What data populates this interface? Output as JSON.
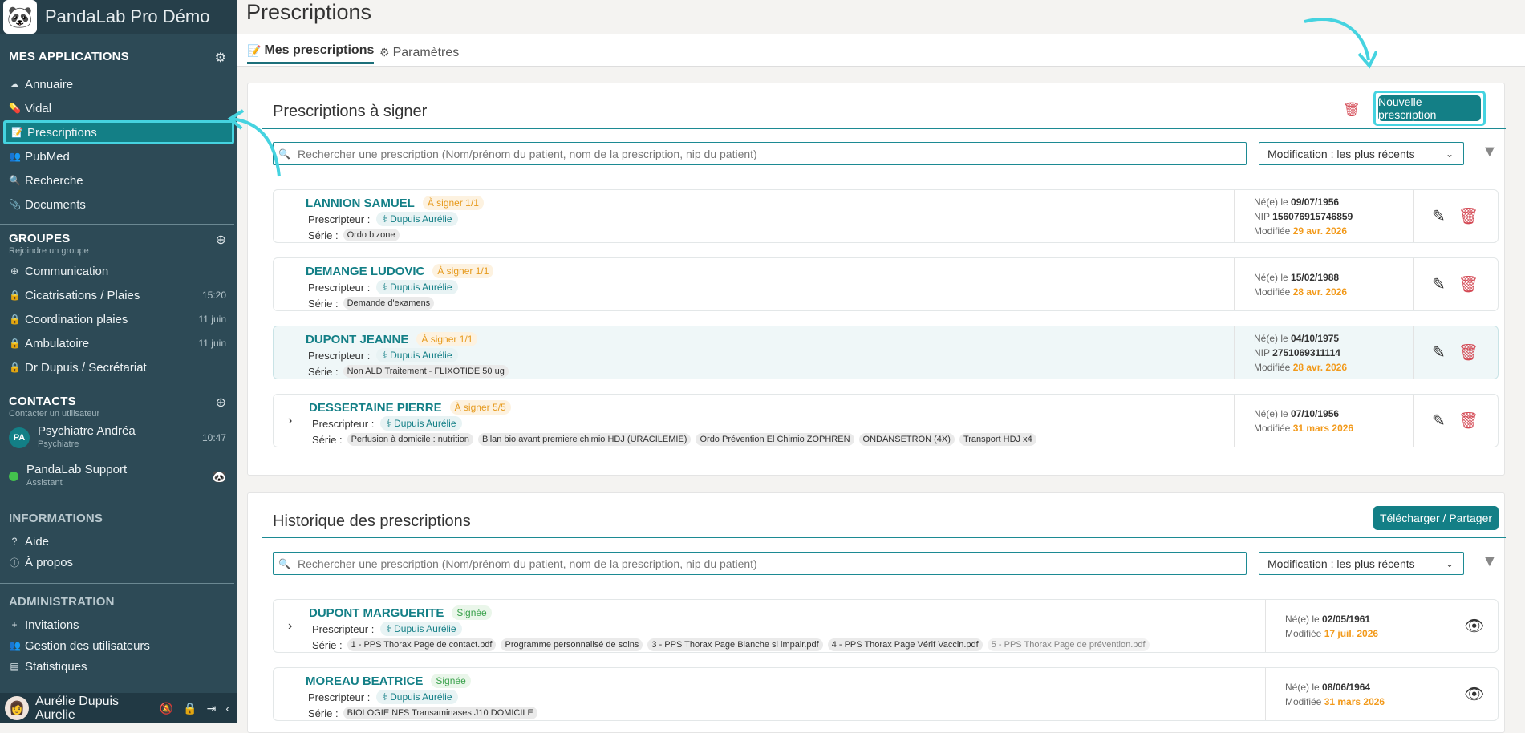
{
  "app": {
    "name": "PandaLab Pro Démo"
  },
  "sidebar": {
    "apps_title": "MES APPLICATIONS",
    "apps": [
      {
        "label": "Annuaire"
      },
      {
        "label": "Vidal"
      },
      {
        "label": "Prescriptions"
      },
      {
        "label": "PubMed"
      },
      {
        "label": "Recherche"
      },
      {
        "label": "Documents"
      }
    ],
    "groups_title": "GROUPES",
    "groups_sub": "Rejoindre un groupe",
    "groups": [
      {
        "label": "Communication",
        "time": ""
      },
      {
        "label": "Cicatrisations / Plaies",
        "time": "15:20"
      },
      {
        "label": "Coordination plaies",
        "time": "11 juin"
      },
      {
        "label": "Ambulatoire",
        "time": "11 juin"
      },
      {
        "label": "Dr Dupuis / Secrétariat",
        "time": ""
      }
    ],
    "contacts_title": "CONTACTS",
    "contacts_sub": "Contacter un utilisateur",
    "contacts": [
      {
        "initials": "PA",
        "name": "Psychiatre Andréa",
        "role": "Psychiatre",
        "time": "10:47"
      },
      {
        "name": "PandaLab Support",
        "role": "Assistant"
      }
    ],
    "info_title": "INFORMATIONS",
    "info": [
      {
        "label": "Aide"
      },
      {
        "label": "À propos"
      }
    ],
    "admin_title": "ADMINISTRATION",
    "admin": [
      {
        "label": "Invitations"
      },
      {
        "label": "Gestion des utilisateurs"
      },
      {
        "label": "Statistiques"
      }
    ],
    "user": {
      "first": "Aurélie Dupuis",
      "second": "Aurelie"
    }
  },
  "page": {
    "title": "Prescriptions",
    "tabs": [
      {
        "label": "Mes prescriptions"
      },
      {
        "label": "Paramètres"
      }
    ]
  },
  "to_sign": {
    "title": "Prescriptions à signer",
    "new_button": "Nouvelle prescription",
    "search_placeholder": "Rechercher une prescription (Nom/prénom du patient, nom de la prescription, nip du patient)",
    "sort": "Modification : les plus récents",
    "rows": [
      {
        "name": "LANNION SAMUEL",
        "status": "À signer 1/1",
        "prescriber_label": "Prescripteur :",
        "prescriber": "Dupuis Aurélie",
        "serie_label": "Série :",
        "tags": [
          "Ordo bizone"
        ],
        "born_label": "Né(e) le",
        "born": "09/07/1956",
        "nip_label": "NIP",
        "nip": "156076915746859",
        "mod_label": "Modifiée",
        "modified": "29 avr. 2026"
      },
      {
        "name": "DEMANGE LUDOVIC",
        "status": "À signer 1/1",
        "prescriber_label": "Prescripteur :",
        "prescriber": "Dupuis Aurélie",
        "serie_label": "Série :",
        "tags": [
          "Demande d'examens"
        ],
        "born_label": "Né(e) le",
        "born": "15/02/1988",
        "mod_label": "Modifiée",
        "modified": "28 avr. 2026"
      },
      {
        "name": "DUPONT JEANNE",
        "status": "À signer 1/1",
        "prescriber_label": "Prescripteur :",
        "prescriber": "Dupuis Aurélie",
        "serie_label": "Série :",
        "tags": [
          "Non ALD Traitement - FLIXOTIDE 50 ug"
        ],
        "born_label": "Né(e) le",
        "born": "04/10/1975",
        "nip_label": "NIP",
        "nip": "2751069311114",
        "mod_label": "Modifiée",
        "modified": "28 avr. 2026"
      },
      {
        "name": "DESSERTAINE PIERRE",
        "status": "À signer 5/5",
        "prescriber_label": "Prescripteur :",
        "prescriber": "Dupuis Aurélie",
        "serie_label": "Série :",
        "tags": [
          "Perfusion à domicile : nutrition",
          "Bilan bio avant premiere chimio HDJ (URACILEMIE)",
          "Ordo Prévention El Chimio ZOPHREN",
          "ONDANSETRON (4X)",
          "Transport HDJ x4"
        ],
        "born_label": "Né(e) le",
        "born": "07/10/1956",
        "mod_label": "Modifiée",
        "modified": "31 mars 2026"
      }
    ]
  },
  "history": {
    "title": "Historique des prescriptions",
    "download_button": "Télécharger / Partager",
    "search_placeholder": "Rechercher une prescription (Nom/prénom du patient, nom de la prescription, nip du patient)",
    "sort": "Modification : les plus récents",
    "rows": [
      {
        "name": "DUPONT MARGUERITE",
        "status": "Signée",
        "prescriber_label": "Prescripteur :",
        "prescriber": "Dupuis Aurélie",
        "serie_label": "Série :",
        "tags": [
          "1 - PPS Thorax Page de contact.pdf",
          "Programme personnalisé de soins",
          "3 - PPS Thorax Page Blanche si impair.pdf",
          "4 - PPS Thorax Page Vérif Vaccin.pdf",
          "5 - PPS Thorax Page de prévention.pdf"
        ],
        "born_label": "Né(e) le",
        "born": "02/05/1961",
        "mod_label": "Modifiée",
        "modified": "17 juil. 2026"
      },
      {
        "name": "MOREAU BEATRICE",
        "status": "Signée",
        "prescriber_label": "Prescripteur :",
        "prescriber": "Dupuis Aurélie",
        "serie_label": "Série :",
        "tags": [
          "BIOLOGIE NFS Transaminases J10 DOMICILE"
        ],
        "born_label": "Né(e) le",
        "born": "08/06/1964",
        "mod_label": "Modifiée",
        "modified": "31 mars 2026"
      }
    ]
  },
  "colors": {
    "accent": "#137f86",
    "highlight": "#45d3e0",
    "sidebar": "#2d4a56",
    "warning": "#f29a1b",
    "danger": "#d44a55"
  }
}
